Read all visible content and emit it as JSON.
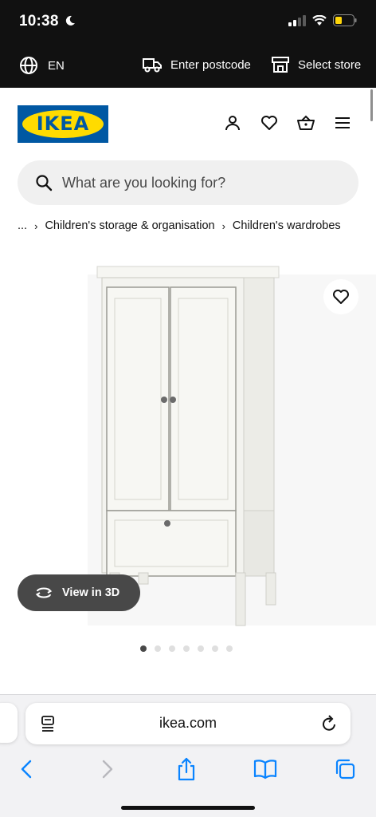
{
  "status": {
    "time": "10:38"
  },
  "utility": {
    "language": "EN",
    "postcode": "Enter postcode",
    "store": "Select store"
  },
  "header": {
    "logo_text": "IKEA"
  },
  "search": {
    "placeholder": "What are you looking for?"
  },
  "breadcrumb": [
    "...",
    "Children's storage & organisation",
    "Children's wardrobes"
  ],
  "product": {
    "view_3d_label": "View in 3D",
    "image_count": 7,
    "active_image": 1
  },
  "browser": {
    "url": "ikea.com"
  },
  "colors": {
    "ikea_blue": "#0058a3",
    "ikea_yellow": "#ffdb00",
    "dark_bar": "#111111",
    "pill": "#484848"
  },
  "icons": [
    "globe-icon",
    "truck-icon",
    "store-icon",
    "user-icon",
    "heart-icon",
    "basket-icon",
    "menu-icon",
    "search-icon",
    "3d-rotate-icon",
    "reader-icon",
    "reload-icon",
    "back-icon",
    "forward-icon",
    "share-icon",
    "bookmarks-icon",
    "tabs-icon"
  ]
}
